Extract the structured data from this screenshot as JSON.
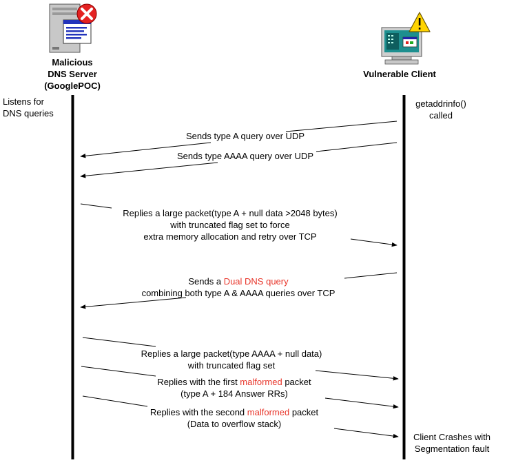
{
  "actors": {
    "server": {
      "name_lines": [
        "Malicious",
        "DNS Server",
        "(GooglePOC)"
      ],
      "icon": "malicious-server-icon",
      "badge": "error-x-icon"
    },
    "client": {
      "name": "Vulnerable Client",
      "icon": "client-computer-icon",
      "badge": "warning-triangle-icon"
    }
  },
  "notes": {
    "server_listen": [
      "Listens for",
      "DNS queries"
    ],
    "client_call": [
      "getaddrinfo()",
      "called"
    ],
    "client_crash": [
      "Client Crashes with",
      "Segmentation fault"
    ]
  },
  "messages": [
    {
      "direction": "client-to-server",
      "lines": [
        [
          "Sends type A query over UDP"
        ]
      ]
    },
    {
      "direction": "client-to-server",
      "lines": [
        [
          "Sends type AAAA query over UDP"
        ]
      ]
    },
    {
      "direction": "server-to-client",
      "lines": [
        [
          "Replies a large packet(type A + null data >2048 bytes)"
        ],
        [
          "with truncated flag set to force"
        ],
        [
          "extra memory allocation and retry over TCP"
        ]
      ]
    },
    {
      "direction": "client-to-server",
      "lines": [
        [
          "Sends a ",
          {
            "text": "Dual DNS query",
            "highlight": true
          }
        ],
        [
          "combining both type A & AAAA queries over TCP"
        ]
      ]
    },
    {
      "direction": "server-to-client",
      "lines": [
        [
          "Replies a large packet(type AAAA + null data)"
        ],
        [
          "with truncated flag set"
        ]
      ]
    },
    {
      "direction": "server-to-client",
      "lines": [
        [
          "Replies with the first ",
          {
            "text": "malformed",
            "highlight": true
          },
          " packet"
        ],
        [
          "(type A + 184 Answer RRs)"
        ]
      ]
    },
    {
      "direction": "server-to-client",
      "lines": [
        [
          "Replies with the second ",
          {
            "text": "malformed",
            "highlight": true
          },
          " packet"
        ],
        [
          "(Data to overflow stack)"
        ]
      ]
    }
  ],
  "colors": {
    "highlight": "#e8362b",
    "line": "#000000",
    "background": "#ffffff"
  }
}
